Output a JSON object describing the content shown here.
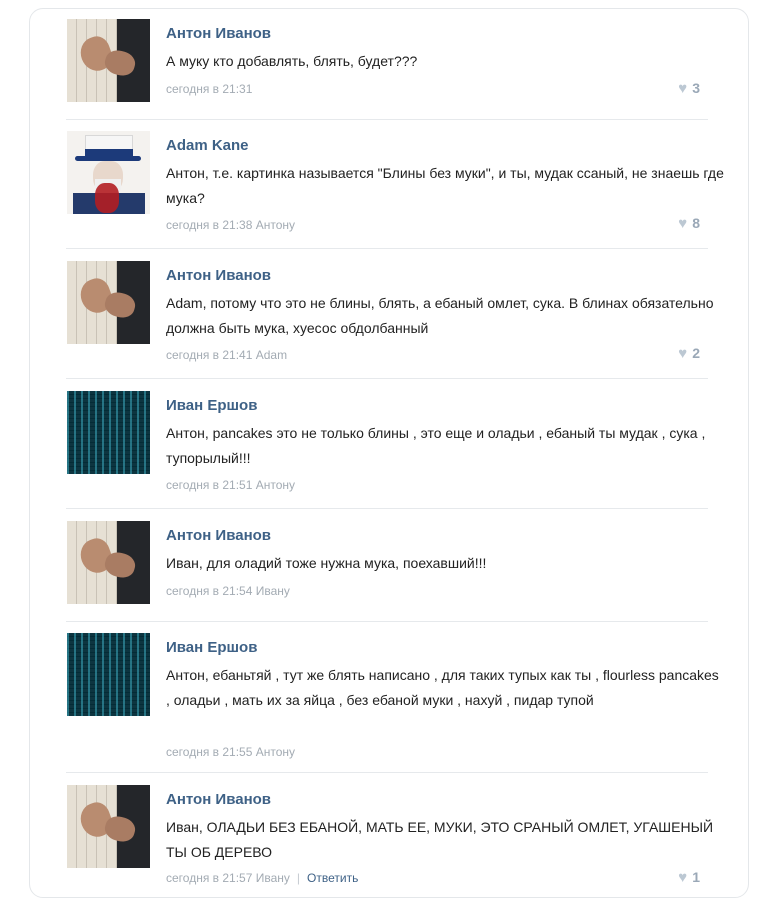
{
  "comments": [
    {
      "author": "Антон Иванов",
      "avatar": "hands-avatar",
      "text": "А муку кто добавлять, блять, будет???",
      "time": "сегодня в 21:31",
      "reply_to": "",
      "likes": "3"
    },
    {
      "author": "Adam Kane",
      "avatar": "uncle-sam-avatar",
      "text": "Антон, т.е. картинка называется \"Блины без муки\", и ты, мудак ссаный, не знаешь где мука?",
      "time": "сегодня в 21:38",
      "reply_to": "Антону",
      "likes": "8"
    },
    {
      "author": "Антон Иванов",
      "avatar": "hands-avatar",
      "text": "Adam, потому что это не блины, блять, а ебаный омлет, сука. В блинах обязательно должна быть мука, хуесос обдолбанный",
      "time": "сегодня в 21:41",
      "reply_to": "Adam",
      "likes": "2"
    },
    {
      "author": "Иван Ершов",
      "avatar": "matrix-avatar",
      "text": "Антон, pancakes это не только блины , это еще и оладьи , ебаный ты мудак , сука , тупорылый!!!",
      "time": "сегодня в 21:51",
      "reply_to": "Антону",
      "likes": ""
    },
    {
      "author": "Антон Иванов",
      "avatar": "hands-avatar",
      "text": "Иван, для оладий тоже нужна мука, поехавший!!!",
      "time": "сегодня в 21:54",
      "reply_to": "Ивану",
      "likes": ""
    },
    {
      "author": "Иван Ершов",
      "avatar": "matrix-avatar",
      "text": "Антон, ебаньтяй , тут же блять написано , для таких тупых как ты , flourless pancakes , оладьи , мать их за яйца , без ебаной муки , нахуй , пидар тупой",
      "time": "сегодня в 21:55",
      "reply_to": "Антону",
      "likes": ""
    },
    {
      "author": "Антон Иванов",
      "avatar": "hands-avatar",
      "text": "Иван, ОЛАДЬИ БЕЗ ЕБАНОЙ, МАТЬ ЕЕ, МУКИ, ЭТО СРАНЫЙ ОМЛЕТ, УГАШЕНЫЙ ТЫ ОБ ДЕРЕВО",
      "time": "сегодня в 21:57",
      "reply_to": "Ивану",
      "reply_label": "Ответить",
      "likes": "1"
    }
  ],
  "icons": {
    "like": "heart-icon"
  },
  "colors": {
    "author": "#3e6186",
    "meta": "#a3abb3",
    "like": "#9aa8b7"
  }
}
